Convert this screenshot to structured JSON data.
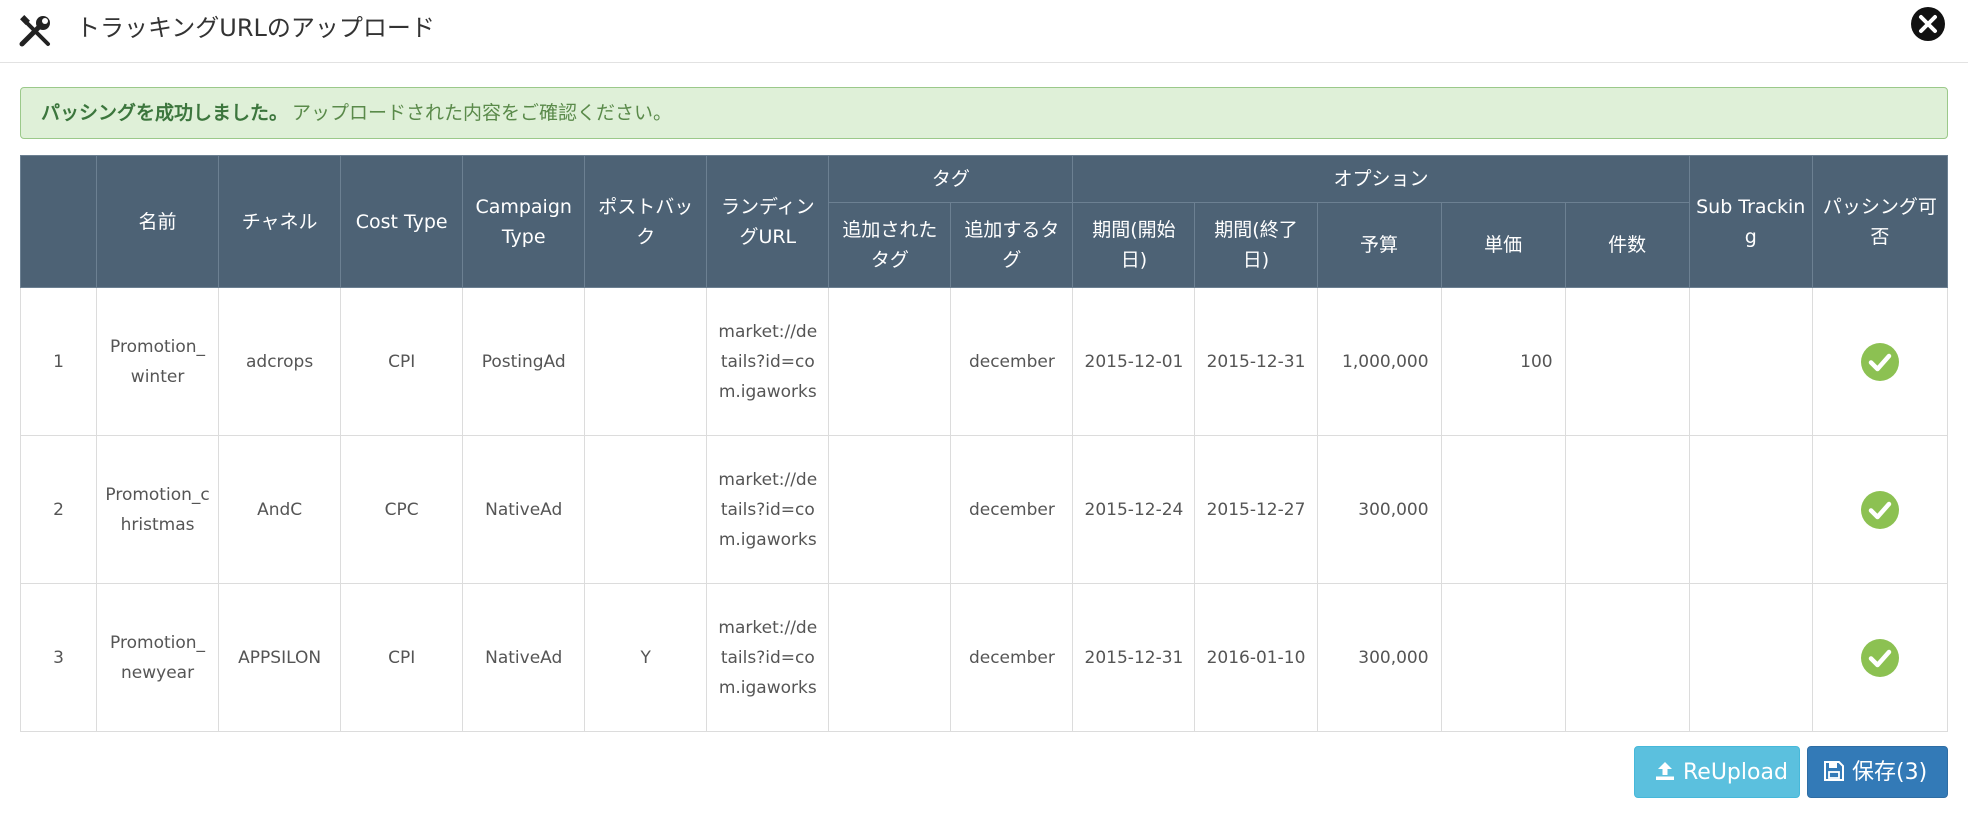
{
  "header": {
    "title": "トラッキングURLのアップロード",
    "icon": "tools-icon",
    "close_icon": "close-icon"
  },
  "alert": {
    "bold": "パッシングを成功しました。",
    "message": "アップロードされた内容をご確認ください。",
    "color": "#dff0d8"
  },
  "table": {
    "headers": {
      "index": "",
      "name": "名前",
      "channel": "チャネル",
      "cost_type": "Cost Type",
      "campaign_type": "Campaign Type",
      "postback": "ポストバック",
      "landing_url": "ランディングURL",
      "tag_group": "タグ",
      "added_tag": "追加されたタグ",
      "tag_to_add": "追加するタグ",
      "option_group": "オプション",
      "period_start": "期間(開始日)",
      "period_end": "期間(終了日)",
      "budget": "予算",
      "unit_price": "単価",
      "count": "件数",
      "sub_tracking": "Sub Tracking",
      "parsing_ok": "パッシング可否"
    },
    "rows": [
      {
        "index": "1",
        "name": "Promotion_winter",
        "channel": "adcrops",
        "cost_type": "CPI",
        "campaign_type": "PostingAd",
        "postback": "",
        "landing_url": "market://details?id=com.igaworks",
        "added_tag": "",
        "tag_to_add": "december",
        "period_start": "2015-12-01",
        "period_end": "2015-12-31",
        "budget": "1,000,000",
        "unit_price": "100",
        "count": "",
        "sub_tracking": "",
        "status_icon": "check-circle-icon"
      },
      {
        "index": "2",
        "name": "Promotion_christmas",
        "channel": "AndC",
        "cost_type": "CPC",
        "campaign_type": "NativeAd",
        "postback": "",
        "landing_url": "market://details?id=com.igaworks",
        "added_tag": "",
        "tag_to_add": "december",
        "period_start": "2015-12-24",
        "period_end": "2015-12-27",
        "budget": "300,000",
        "unit_price": "",
        "count": "",
        "sub_tracking": "",
        "status_icon": "check-circle-icon"
      },
      {
        "index": "3",
        "name": "Promotion_newyear",
        "channel": "APPSILON",
        "cost_type": "CPI",
        "campaign_type": "NativeAd",
        "postback": "Y",
        "landing_url": "market://details?id=com.igaworks",
        "added_tag": "",
        "tag_to_add": "december",
        "period_start": "2015-12-31",
        "period_end": "2016-01-10",
        "budget": "300,000",
        "unit_price": "",
        "count": "",
        "sub_tracking": "",
        "status_icon": "check-circle-icon"
      }
    ]
  },
  "buttons": {
    "reupload_label": "ReUpload",
    "reupload_icon": "upload-icon",
    "save_label": "保存(3)",
    "save_icon": "floppy-disk-icon"
  },
  "colors": {
    "header_bg": "#4d6275",
    "reupload": "#5bc0de",
    "save": "#337ab7",
    "check": "#8cc152"
  }
}
